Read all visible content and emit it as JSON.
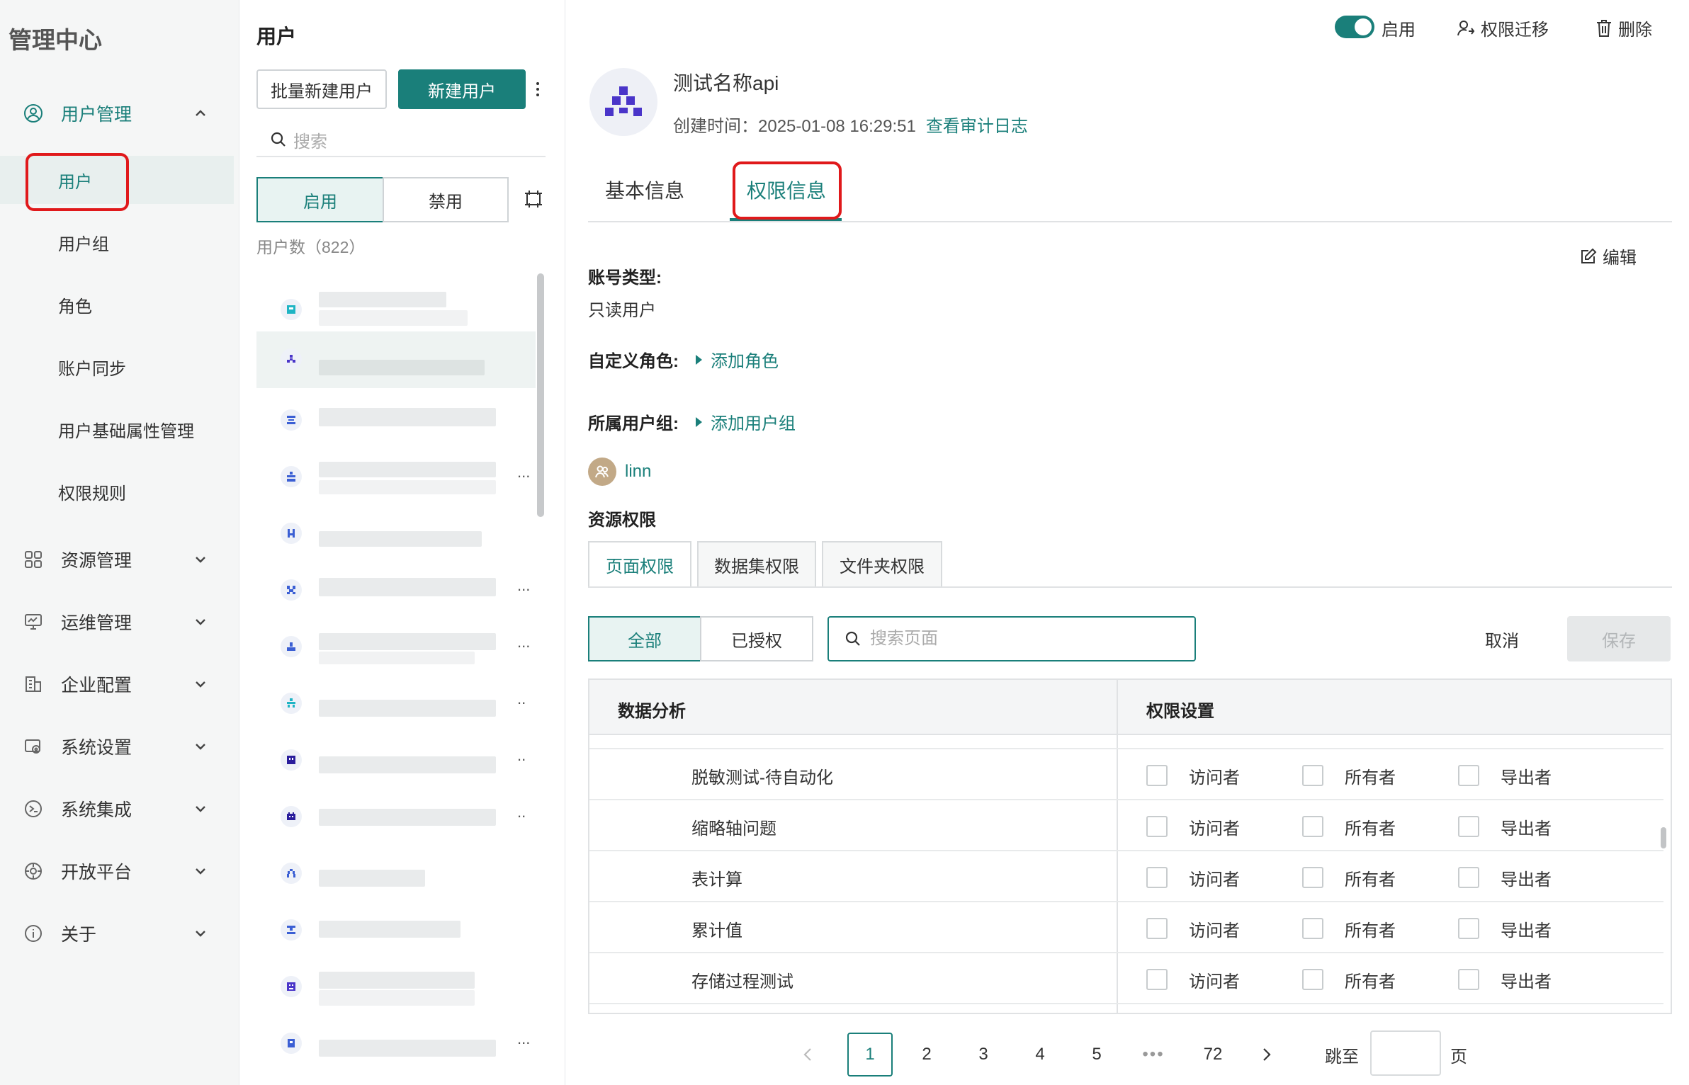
{
  "app": {
    "title": "管理中心"
  },
  "sidebar": {
    "groups": [
      {
        "label": "用户管理",
        "icon": "user-circle-icon",
        "expanded": true
      },
      {
        "label": "资源管理",
        "icon": "grid-icon"
      },
      {
        "label": "运维管理",
        "icon": "monitor-icon"
      },
      {
        "label": "企业配置",
        "icon": "building-icon"
      },
      {
        "label": "系统设置",
        "icon": "settings-icon"
      },
      {
        "label": "系统集成",
        "icon": "integration-icon"
      },
      {
        "label": "开放平台",
        "icon": "platform-icon"
      },
      {
        "label": "关于",
        "icon": "info-icon"
      }
    ],
    "user_mgmt_items": [
      "用户",
      "用户组",
      "角色",
      "账户同步",
      "用户基础属性管理",
      "权限规则"
    ],
    "selected": "用户"
  },
  "user_list": {
    "title": "用户",
    "batch_create": "批量新建用户",
    "create": "新建用户",
    "search_placeholder": "搜索",
    "tabs": [
      "启用",
      "禁用"
    ],
    "count": "用户数（822）"
  },
  "header": {
    "status_label": "启用",
    "transfer_label": "权限迁移",
    "delete_label": "删除",
    "user_name": "测试名称api",
    "created_prefix": "创建时间：",
    "created_time": "2025-01-08 16:29:51",
    "audit_link": "查看审计日志"
  },
  "tabs": [
    "基本信息",
    "权限信息"
  ],
  "permissions": {
    "edit_label": "编辑",
    "account_type_label": "账号类型:",
    "account_type_value": "只读用户",
    "custom_role_label": "自定义角色:",
    "add_role": "添加角色",
    "user_group_label": "所属用户组:",
    "add_group": "添加用户组",
    "group_member": "linn",
    "resource_label": "资源权限",
    "resource_tabs": [
      "页面权限",
      "数据集权限",
      "文件夹权限"
    ],
    "filter_tabs": [
      "全部",
      "已授权"
    ],
    "search_placeholder": "搜索页面",
    "cancel": "取消",
    "save": "保存",
    "table": {
      "col1": "数据分析",
      "col2": "权限设置",
      "rows": [
        {
          "name": "脱敏测试-待自动化"
        },
        {
          "name": "缩略轴问题"
        },
        {
          "name": "表计算"
        },
        {
          "name": "累计值"
        },
        {
          "name": "存储过程测试"
        }
      ],
      "options": [
        "访问者",
        "所有者",
        "导出者"
      ]
    }
  },
  "pagination": {
    "pages": [
      "1",
      "2",
      "3",
      "4",
      "5",
      "72"
    ],
    "current": "1",
    "jump_label": "跳至",
    "page_suffix": "页"
  }
}
